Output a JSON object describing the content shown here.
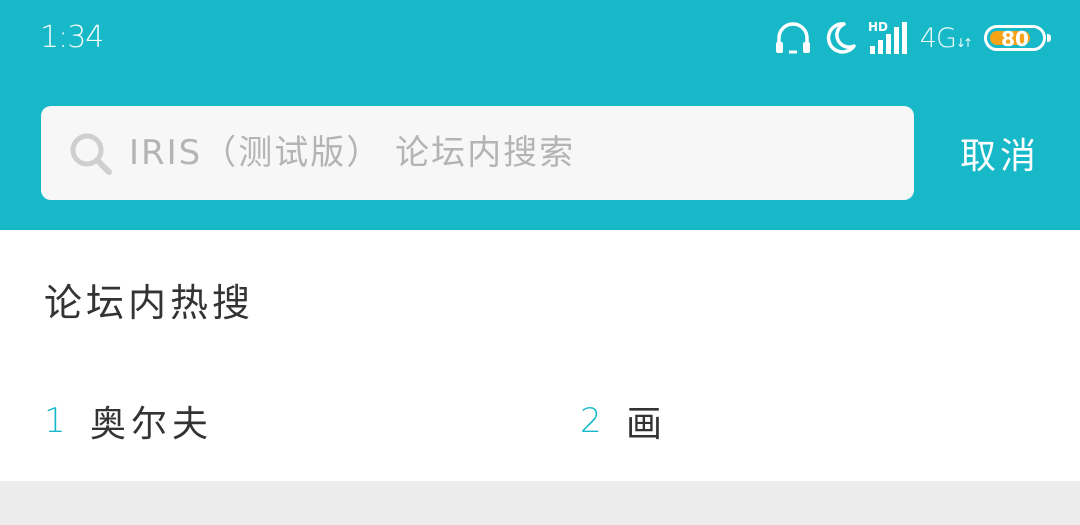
{
  "status_bar": {
    "time": "1:34",
    "network": "4G",
    "signal_badge": "HD",
    "battery_percent": "80",
    "icons": [
      "headphones-icon",
      "moon-icon",
      "signal-icon",
      "battery-icon"
    ]
  },
  "search": {
    "placeholder": "IRIS（测试版） 论坛内搜索",
    "value": "",
    "cancel_label": "取消"
  },
  "hot_search": {
    "title": "论坛内热搜",
    "items": [
      {
        "rank": "1",
        "term": "奥尔夫"
      },
      {
        "rank": "2",
        "term": "画"
      }
    ]
  },
  "colors": {
    "accent": "#17b8c8",
    "battery": "#f5a417",
    "background": "#ececec"
  }
}
